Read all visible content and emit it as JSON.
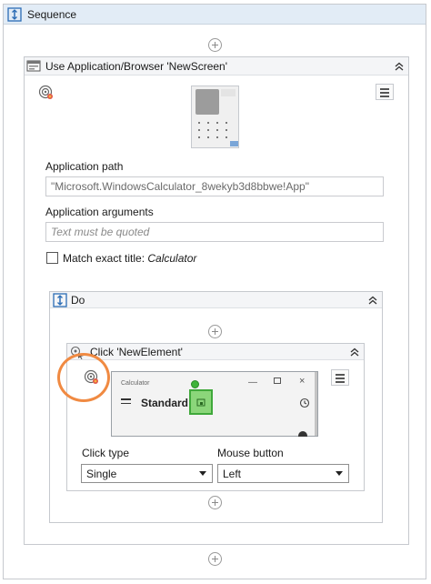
{
  "sequence": {
    "title": "Sequence"
  },
  "use_app": {
    "title": "Use Application/Browser 'NewScreen'",
    "application_path_label": "Application path",
    "application_path_value": "\"Microsoft.WindowsCalculator_8wekyb3d8bbwe!App\"",
    "application_arguments_label": "Application arguments",
    "application_arguments_placeholder": "Text must be quoted",
    "match_title_prefix": "Match exact title: ",
    "match_title_value": "Calculator",
    "match_title_checked": false
  },
  "do": {
    "title": "Do"
  },
  "click": {
    "title": "Click 'NewElement'",
    "preview": {
      "window_title": "Calculator",
      "mode_label": "Standard"
    },
    "click_type_label": "Click type",
    "click_type_value": "Single",
    "mouse_button_label": "Mouse button",
    "mouse_button_value": "Left"
  },
  "icons": {
    "sequence": "sequence-icon",
    "use_app": "use-application-icon",
    "target": "target-icon",
    "menu": "hamburger-menu-icon",
    "collapse": "collapse-chevron-icon",
    "add": "add-activity-icon"
  },
  "colors": {
    "header_blue": "#e2ecf6",
    "highlight_green": "#8bd67a",
    "annotation_orange": "#f08a42"
  }
}
